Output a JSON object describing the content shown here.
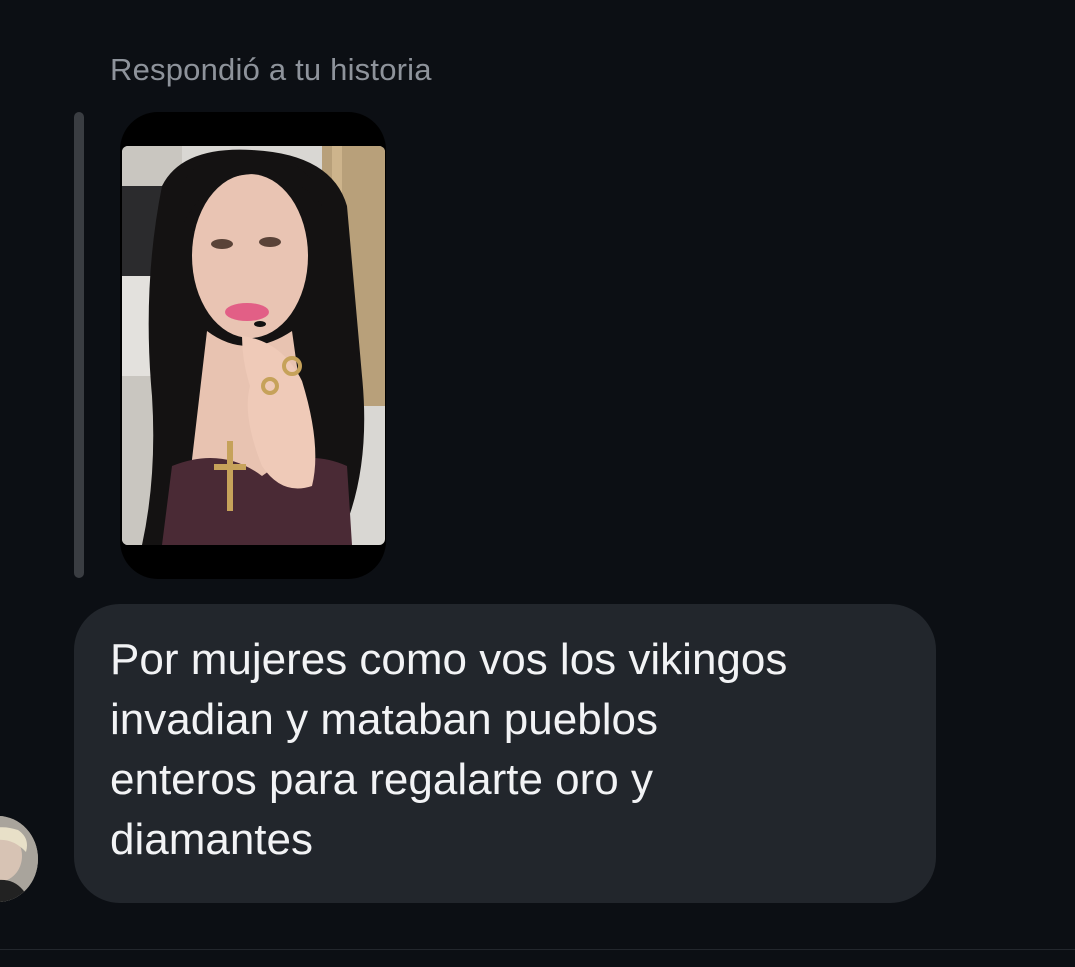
{
  "message": {
    "reply_context": "Respondió a tu historia",
    "text": "Por mujeres como vos los vikingos\ninvadian y mataban pueblos\nenteros para regalarte oro y\ndiamantes",
    "story_thumbnail": "story-photo",
    "sender_avatar": "avatar-photo"
  },
  "colors": {
    "background": "#0c0f14",
    "bubble": "#22262c",
    "reply_label": "#8e939b",
    "message_text": "#f2f3f5",
    "quote_bar": "#3a3d42"
  }
}
